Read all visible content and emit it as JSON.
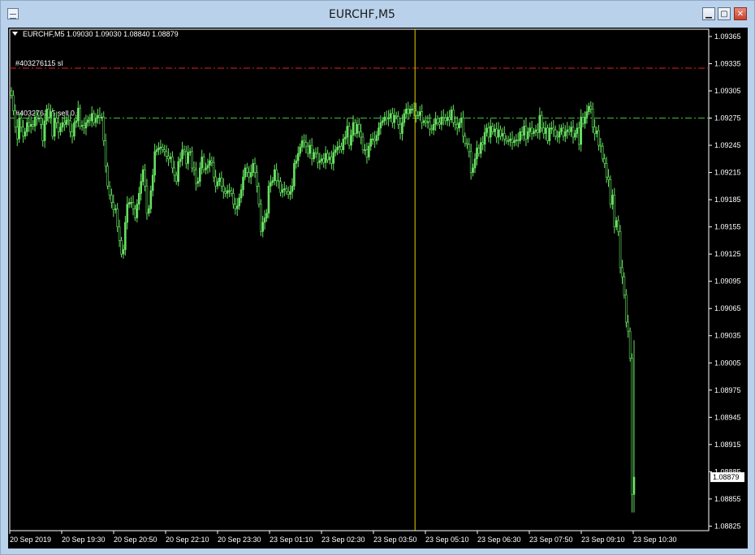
{
  "window": {
    "title": "EURCHF,M5",
    "buttons": {
      "minimize": "▁",
      "maximize": "▢",
      "close": "✕"
    }
  },
  "chart_data": {
    "type": "candlestick",
    "symbol_info": "EURCHF,M5  1.09030 1.09030 1.08840 1.08879",
    "y_ticks": [
      1.09365,
      1.09335,
      1.09305,
      1.09275,
      1.09245,
      1.09215,
      1.09185,
      1.09155,
      1.09125,
      1.09095,
      1.09065,
      1.09035,
      1.09005,
      1.08975,
      1.08945,
      1.08915,
      1.08885,
      1.08855,
      1.08825
    ],
    "ylim": [
      1.0882,
      1.09373
    ],
    "x_labels": [
      "20 Sep 2019",
      "20 Sep 19:30",
      "20 Sep 20:50",
      "20 Sep 22:10",
      "20 Sep 23:30",
      "23 Sep 01:10",
      "23 Sep 02:30",
      "23 Sep 03:50",
      "23 Sep 05:10",
      "23 Sep 06:30",
      "23 Sep 07:50",
      "23 Sep 09:10",
      "23 Sep 10:30"
    ],
    "current_price": "1.08879",
    "current_price_value": 1.08879,
    "hlines": [
      {
        "label": "#403276115 sl",
        "value": 1.0933,
        "color": "#e02020"
      },
      {
        "label": "#403276115 sell 0.0",
        "value": 1.09275,
        "color": "#40c040"
      }
    ],
    "crosshair_label": "23 Sep 03:50",
    "candle_color": "#66e060",
    "closes": [
      1.093,
      1.09283,
      1.09265,
      1.09252,
      1.09275,
      1.09265,
      1.09255,
      1.0926,
      1.0927,
      1.09266,
      1.09268,
      1.09266,
      1.09276,
      1.09274,
      1.09275,
      1.09268,
      1.0925,
      1.09272,
      1.09285,
      1.09276,
      1.09282,
      1.09255,
      1.09275,
      1.0927,
      1.0926,
      1.09265,
      1.0927,
      1.09268,
      1.09273,
      1.09272,
      1.0926,
      1.09255,
      1.0927,
      1.09272,
      1.09286,
      1.09266,
      1.09267,
      1.09264,
      1.0927,
      1.09273,
      1.09272,
      1.0928,
      1.0927,
      1.09275,
      1.09278,
      1.09276,
      1.09276,
      1.0925,
      1.09222,
      1.092,
      1.0919,
      1.09182,
      1.09174,
      1.09175,
      1.09155,
      1.0914,
      1.09125,
      1.0913,
      1.0916,
      1.0918,
      1.09182,
      1.09182,
      1.09175,
      1.09165,
      1.0918,
      1.09192,
      1.09205,
      1.09218,
      1.092,
      1.0917,
      1.09175,
      1.09195,
      1.09212,
      1.09238,
      1.0924,
      1.09242,
      1.09243,
      1.0924,
      1.09238,
      1.09233,
      1.0923,
      1.09232,
      1.0922,
      1.09212,
      1.09205,
      1.09227,
      1.0923,
      1.0924,
      1.09238,
      1.09225,
      1.09237,
      1.09238,
      1.0922,
      1.09218,
      1.09203,
      1.09205,
      1.0922,
      1.09232,
      1.09218,
      1.0922,
      1.09223,
      1.09228,
      1.09226,
      1.0921,
      1.092,
      1.09205,
      1.09209,
      1.092,
      1.09194,
      1.09192,
      1.09195,
      1.09195,
      1.09192,
      1.0918,
      1.09175,
      1.09178,
      1.09187,
      1.09196,
      1.0921,
      1.0922,
      1.09215,
      1.0921,
      1.09215,
      1.09225,
      1.09215,
      1.092,
      1.0918,
      1.0915,
      1.0916,
      1.09165,
      1.0917,
      1.092,
      1.09204,
      1.09206,
      1.09218,
      1.09206,
      1.09205,
      1.09193,
      1.09196,
      1.09197,
      1.09194,
      1.09191,
      1.09194,
      1.092,
      1.09225,
      1.09228,
      1.09236,
      1.09243,
      1.0925,
      1.09248,
      1.09244,
      1.09236,
      1.09245,
      1.0923,
      1.09237,
      1.09236,
      1.09226,
      1.09228,
      1.0923,
      1.09226,
      1.09236,
      1.09229,
      1.09232,
      1.09225,
      1.09237,
      1.0924,
      1.09243,
      1.09244,
      1.0924,
      1.09252,
      1.09254,
      1.09266,
      1.09245,
      1.09256,
      1.0927,
      1.09258,
      1.09268,
      1.0926,
      1.09254,
      1.0924,
      1.0924,
      1.09232,
      1.09244,
      1.09252,
      1.09252,
      1.0925,
      1.09256,
      1.09264,
      1.0927,
      1.09272,
      1.09276,
      1.09274,
      1.09275,
      1.0928,
      1.0927,
      1.09278,
      1.09277,
      1.09268,
      1.09258,
      1.0927,
      1.0928,
      1.09285,
      1.0928,
      1.09285,
      1.09285,
      1.09283,
      1.09278,
      1.09278,
      1.09282,
      1.0927,
      1.09272,
      1.0927,
      1.09271,
      1.09263,
      1.09262,
      1.09268,
      1.09274,
      1.0927,
      1.09268,
      1.09276,
      1.09275,
      1.09272,
      1.09276,
      1.09273,
      1.09284,
      1.0927,
      1.09268,
      1.09264,
      1.0927,
      1.09275,
      1.09255,
      1.09247,
      1.09246,
      1.09238,
      1.09215,
      1.0922,
      1.0923,
      1.09242,
      1.09236,
      1.09248,
      1.09246,
      1.09259,
      1.09264,
      1.09254,
      1.09266,
      1.0926,
      1.09263,
      1.09254,
      1.09262,
      1.09255,
      1.09258,
      1.09252,
      1.0925,
      1.0925,
      1.09252,
      1.09248,
      1.0925,
      1.09251,
      1.0925,
      1.0926,
      1.09256,
      1.09266,
      1.09252,
      1.0926,
      1.09264,
      1.09258,
      1.0926,
      1.09262,
      1.09259,
      1.09278,
      1.09264,
      1.09258,
      1.09264,
      1.0925,
      1.09264,
      1.09264,
      1.09262,
      1.09255,
      1.09254,
      1.0926,
      1.09264,
      1.09255,
      1.0926,
      1.09262,
      1.0926,
      1.09265,
      1.09254,
      1.09258,
      1.09264,
      1.09246,
      1.09276,
      1.09269,
      1.09276,
      1.09282,
      1.09288,
      1.09285,
      1.09265,
      1.09258,
      1.09261,
      1.09245,
      1.09244,
      1.0923,
      1.09225,
      1.0921,
      1.09207,
      1.0918,
      1.0919,
      1.09155,
      1.09162,
      1.0915,
      1.0911,
      1.091,
      1.0908,
      1.0905,
      1.0904,
      1.0901,
      1.0886,
      1.08879
    ]
  }
}
